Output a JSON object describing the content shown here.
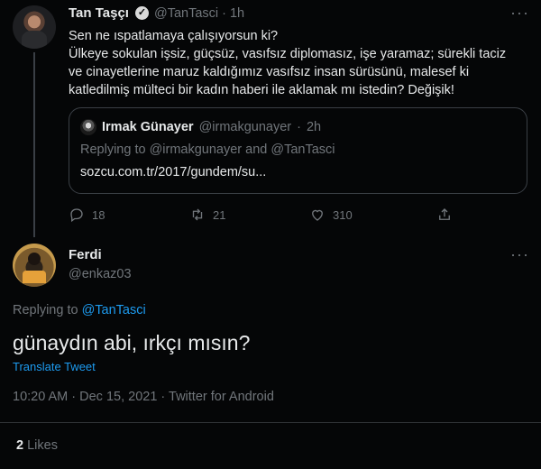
{
  "parent_tweet": {
    "author_name": "Tan Taşçı",
    "handle": "@TanTasci",
    "separator": "·",
    "time": "1h",
    "text": "Sen ne ıspatlamaya çalışıyorsun ki?\nÜlkeye sokulan işsiz, güçsüz, vasıfsız diplomasız, işe yaramaz; sürekli taciz\nve cinayetlerine maruz kaldığımız vasıfsız insan sürüsünü, malesef ki\nkatledilmiş mülteci bir kadın haberi ile aklamak mı istedin?  Değişik!",
    "quote": {
      "author_name": "Irmak Günayer",
      "handle": "@irmakgunayer",
      "separator": "·",
      "time": "2h",
      "replying_to": "Replying to @irmakgunayer and @TanTasci",
      "link": "sozcu.com.tr/2017/gundem/su..."
    },
    "actions": {
      "replies": "18",
      "retweets": "21",
      "likes": "310"
    },
    "more": "···"
  },
  "reply_tweet": {
    "author_name": "Ferdi",
    "handle": "@enkaz03",
    "replying_label": "Replying to",
    "replying_handle": "@TanTasci",
    "text": "günaydın abi, ırkçı mısın?",
    "translate": "Translate Tweet",
    "meta": "10:20 AM · Dec 15, 2021 · Twitter for Android",
    "more": "···",
    "likes_count": "2",
    "likes_label": "Likes"
  }
}
